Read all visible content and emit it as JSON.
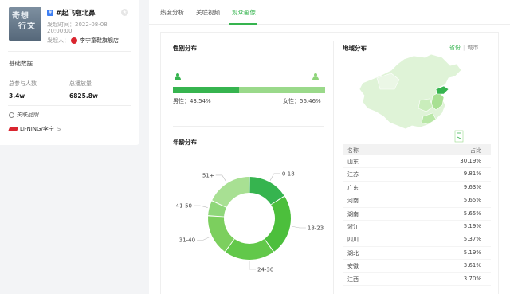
{
  "topic": {
    "cover_text_1": "奇想",
    "cover_text_2": "行文",
    "title": "#起飞啦北鼻",
    "time_label": "发起时间：2022-08-08",
    "time_value": "20:00:00",
    "publisher_label": "发起人：",
    "publisher_name": "李宁童鞋旗舰店"
  },
  "basic": {
    "title": "基础数据",
    "participants_label": "总参与人数",
    "participants_value": "3.4w",
    "plays_label": "总播放量",
    "plays_value": "6825.8w"
  },
  "brand": {
    "title": "关联品牌",
    "name": "LI-NING/李宁",
    "chevron": ">"
  },
  "tabs": [
    "热度分析",
    "关联视频",
    "观众画像"
  ],
  "gender": {
    "title": "性别分布",
    "male_label": "男性：43.54%",
    "female_label": "女性：56.46%",
    "male_ratio": 0.4354,
    "male_color": "#36b44f",
    "female_color": "#9ad98a"
  },
  "age": {
    "title": "年龄分布"
  },
  "region": {
    "title": "地域分布",
    "toggle_on": "省份",
    "toggle_sep": "|",
    "toggle_off": "城市",
    "col_name": "名称",
    "col_ratio": "占比",
    "rows": [
      {
        "name": "山东",
        "value": "30.19%"
      },
      {
        "name": "江苏",
        "value": "9.81%"
      },
      {
        "name": "广东",
        "value": "9.63%"
      },
      {
        "name": "河南",
        "value": "5.65%"
      },
      {
        "name": "湖南",
        "value": "5.65%"
      },
      {
        "name": "浙江",
        "value": "5.19%"
      },
      {
        "name": "四川",
        "value": "5.37%"
      },
      {
        "name": "湖北",
        "value": "5.19%"
      },
      {
        "name": "安徽",
        "value": "3.61%"
      },
      {
        "name": "江西",
        "value": "3.70%"
      }
    ]
  },
  "chart_data": {
    "type": "pie",
    "categories": [
      "0-18",
      "18-23",
      "24-30",
      "31-40",
      "41-50",
      "51+"
    ],
    "values": [
      16,
      24,
      20,
      16,
      6,
      18
    ],
    "colors": [
      "#36b44f",
      "#4cbf3c",
      "#62c84a",
      "#7ccf5e",
      "#8fd77a",
      "#a8e093"
    ]
  }
}
